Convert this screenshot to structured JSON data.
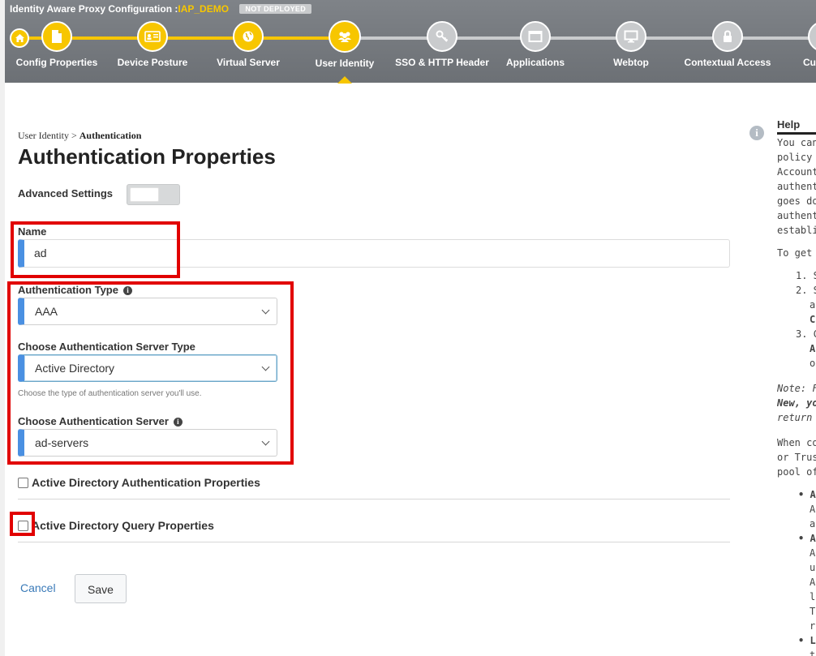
{
  "header": {
    "title": "Identity Aware Proxy Configuration :",
    "policy_name": "IAP_DEMO",
    "status_badge": "NOT DEPLOYED",
    "active_step": "User Identity",
    "steps": [
      {
        "label": "Config Properties",
        "icon": "document-icon",
        "state": "done"
      },
      {
        "label": "Device Posture",
        "icon": "id-card-icon",
        "state": "done"
      },
      {
        "label": "Virtual Server",
        "icon": "globe-icon",
        "state": "done"
      },
      {
        "label": "User Identity",
        "icon": "users-icon",
        "state": "active"
      },
      {
        "label": "SSO & HTTP Header",
        "icon": "key-icon",
        "state": "todo"
      },
      {
        "label": "Applications",
        "icon": "window-icon",
        "state": "todo"
      },
      {
        "label": "Webtop",
        "icon": "monitor-icon",
        "state": "todo"
      },
      {
        "label": "Contextual Access",
        "icon": "lock-icon",
        "state": "todo"
      },
      {
        "label": "Custo",
        "icon": "gear-icon",
        "state": "todo"
      }
    ],
    "colors": {
      "accent": "#f7c600",
      "inactive": "#c9cbcd",
      "bar": "#7f8388"
    }
  },
  "breadcrumb": {
    "parent": "User Identity",
    "separator": " > ",
    "current": "Authentication"
  },
  "page_title": "Authentication Properties",
  "advanced_settings": {
    "label": "Advanced Settings",
    "enabled": false
  },
  "form": {
    "name": {
      "label": "Name",
      "value": "ad"
    },
    "auth_type": {
      "label": "Authentication Type",
      "value": "AAA"
    },
    "server_type": {
      "label": "Choose Authentication Server Type",
      "value": "Active Directory",
      "hint": "Choose the type of authentication server you'll use."
    },
    "server": {
      "label": "Choose Authentication Server",
      "value": "ad-servers"
    },
    "ad_auth_props": {
      "label": "Active Directory Authentication Properties",
      "checked": false
    },
    "ad_query_props": {
      "label": "Active Directory Query Properties",
      "checked": false
    }
  },
  "actions": {
    "cancel": "Cancel",
    "save": "Save"
  },
  "help": {
    "title": "Help",
    "lines": [
      "You can",
      "policy us",
      "Account",
      "authenti",
      "goes dov",
      "authenti",
      "establish",
      "To get st",
      "1. S",
      "2. S",
      "a",
      "C",
      "3. C",
      "A",
      "o",
      "Note: Fo",
      "New, yo",
      "return to",
      "When co",
      "or Truste",
      "pool of s",
      "• A",
      "A",
      "a",
      "• A",
      "A",
      "u",
      "A",
      "li",
      "T",
      "re",
      "• L",
      "t"
    ]
  },
  "highlight_color": "#e10000"
}
